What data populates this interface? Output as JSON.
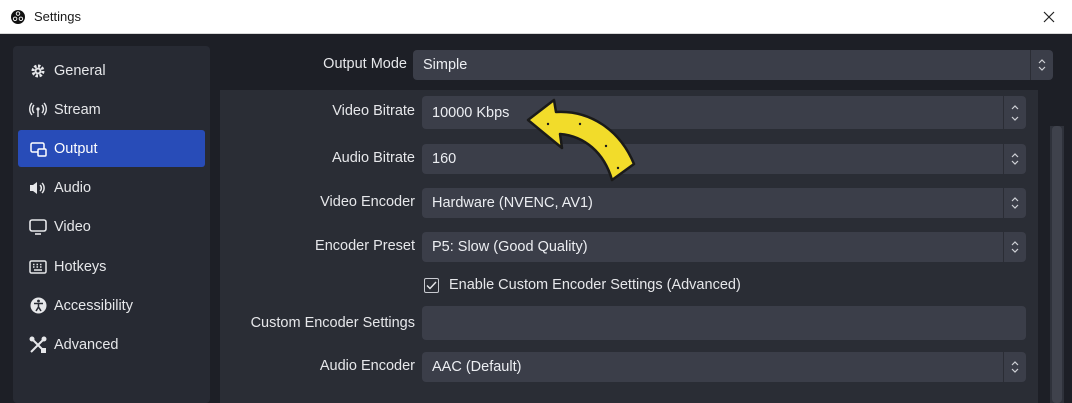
{
  "window": {
    "title": "Settings"
  },
  "sidebar": {
    "items": [
      {
        "label": "General",
        "icon": "gear-icon"
      },
      {
        "label": "Stream",
        "icon": "broadcast-icon"
      },
      {
        "label": "Output",
        "icon": "output-icon",
        "active": true
      },
      {
        "label": "Audio",
        "icon": "speaker-icon"
      },
      {
        "label": "Video",
        "icon": "monitor-icon"
      },
      {
        "label": "Hotkeys",
        "icon": "keyboard-icon"
      },
      {
        "label": "Accessibility",
        "icon": "accessibility-icon"
      },
      {
        "label": "Advanced",
        "icon": "tools-icon"
      }
    ]
  },
  "output": {
    "output_mode": {
      "label": "Output Mode",
      "value": "Simple"
    },
    "video_bitrate": {
      "label": "Video Bitrate",
      "value": "10000 Kbps"
    },
    "audio_bitrate": {
      "label": "Audio Bitrate",
      "value": "160"
    },
    "video_encoder": {
      "label": "Video Encoder",
      "value": "Hardware (NVENC, AV1)"
    },
    "encoder_preset": {
      "label": "Encoder Preset",
      "value": "P5: Slow (Good Quality)"
    },
    "custom_encoder_checkbox": {
      "label": "Enable Custom Encoder Settings (Advanced)",
      "checked": true
    },
    "custom_encoder_settings": {
      "label": "Custom Encoder Settings",
      "value": ""
    },
    "audio_encoder": {
      "label": "Audio Encoder",
      "value": "AAC (Default)"
    }
  },
  "colors": {
    "accent": "#284cb8",
    "annotation_arrow": "#f2dc2a"
  }
}
